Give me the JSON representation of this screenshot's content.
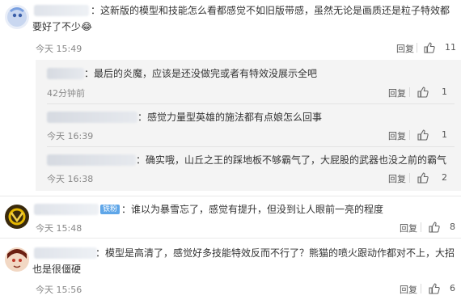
{
  "comments": [
    {
      "text": "：这新版的模型和技能怎么看都感觉不如旧版带感，虽然无论是画质还是粒子特效都要好了不少",
      "emoji": "😂",
      "time": "今天 15:49",
      "reply": "回复",
      "likes": "11"
    },
    {
      "text": "：谁以为暴雪忘了，感觉有提升，但没到让人眼前一亮的程度",
      "badge": "铁粉",
      "time": "今天 15:48",
      "reply": "回复",
      "likes": "8"
    },
    {
      "text": "：模型是高清了，感觉好多技能特效反而不行了？熊猫的喷火跟动作都对不上，大招也是很僵硬",
      "time": "今天 15:56",
      "reply": "回复",
      "likes": "6"
    }
  ],
  "replies": [
    {
      "text": "：最后的炎魔，应该是还没做完或者有特效没展示全吧",
      "time": "42分钟前",
      "reply": "回复",
      "likes": "1"
    },
    {
      "text": "：感觉力量型英雄的施法都有点娘怎么回事",
      "time": "今天 16:39",
      "reply": "回复",
      "likes": "1"
    },
    {
      "text": "：确实哦，山丘之王的踩地板不够霸气了，大屁股的武器也没之前的霸气",
      "time": "今天 16:38",
      "reply": "回复",
      "likes": "2"
    }
  ]
}
